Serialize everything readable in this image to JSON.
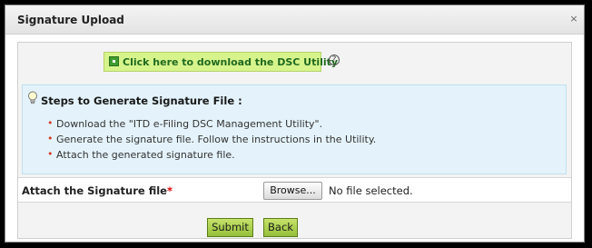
{
  "dialog": {
    "title": "Signature Upload",
    "close_glyph": "×",
    "download_button": {
      "label": "Click here to download the DSC Utility",
      "icon": "download-icon"
    },
    "help_glyph": "?",
    "steps": {
      "icon": "lightbulb-icon",
      "title": "Steps to Generate Signature File :",
      "items": [
        "Download the \"ITD e-Filing DSC Management Utility\".",
        "Generate the signature file. Follow the instructions in the Utility.",
        "Attach the generated signature file."
      ]
    },
    "attach": {
      "label": "Attach the Signature file",
      "required_marker": "*",
      "browse_label": "Browse...",
      "file_status": "No file selected."
    },
    "actions": {
      "submit": "Submit",
      "back": "Back"
    },
    "colors": {
      "download_bg": "#d7f48c",
      "download_text": "#1f6a1f",
      "steps_bg": "#e4f3fb",
      "action_button": "#a8cf46",
      "required": "#dd0000"
    }
  }
}
